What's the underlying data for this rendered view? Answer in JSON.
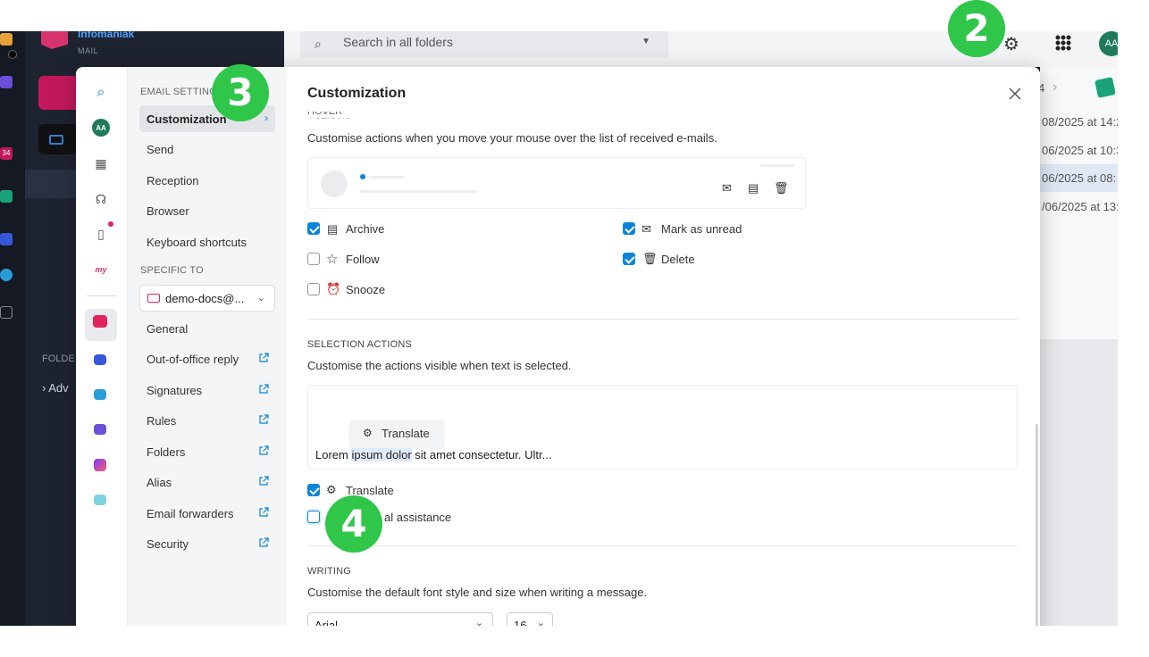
{
  "app": {
    "brand": "Infomaniak",
    "brand_sub": "MAIL",
    "avatar_initials": "AA"
  },
  "search": {
    "placeholder": "Search in all folders"
  },
  "background": {
    "rail_badge": "34",
    "folders_label": "FOLDE",
    "adv_label": "Adv",
    "pager": "4",
    "list_rows": [
      "08/2025 at 14:2",
      "06/2025 at 10:3",
      "06/2025 at 08:",
      "/06/2025 at 13:"
    ]
  },
  "modal": {
    "title": "Customization",
    "sections": {
      "email_settings": "EMAIL SETTINGS",
      "specific_to": "SPECIFIC TO"
    },
    "nav_top": [
      {
        "label": "Customization"
      },
      {
        "label": "Send"
      },
      {
        "label": "Reception"
      },
      {
        "label": "Browser"
      },
      {
        "label": "Keyboard shortcuts"
      }
    ],
    "account": "demo-docs@...",
    "nav_bottom": [
      {
        "label": "General",
        "external": false
      },
      {
        "label": "Out-of-office reply",
        "external": true
      },
      {
        "label": "Signatures",
        "external": true
      },
      {
        "label": "Rules",
        "external": true
      },
      {
        "label": "Folders",
        "external": true
      },
      {
        "label": "Alias",
        "external": true
      },
      {
        "label": "Email forwarders",
        "external": true
      },
      {
        "label": "Security",
        "external": true
      }
    ],
    "hover": {
      "description": "Customise actions when you move your mouse over the list of received e-mails.",
      "options": [
        {
          "label": "Archive",
          "checked": true,
          "icon": "archive-icon"
        },
        {
          "label": "Mark as unread",
          "checked": true,
          "icon": "mail-unread-icon"
        },
        {
          "label": "Follow",
          "checked": false,
          "icon": "star-icon"
        },
        {
          "label": "Delete",
          "checked": true,
          "icon": "trash-icon"
        },
        {
          "label": "Snooze",
          "checked": false,
          "icon": "alarm-icon"
        }
      ]
    },
    "selection": {
      "heading": "SELECTION ACTIONS",
      "description": "Customise the actions visible when text is selected.",
      "popup_label": "Translate",
      "lorem_before": "Lorem ",
      "lorem_highlight": "ipsum dolor",
      "lorem_after": " sit amet consectetur. Ultr...",
      "options": [
        {
          "label": "Translate",
          "checked": true,
          "icon": "translate-icon"
        },
        {
          "label": "al assistance",
          "checked": false
        }
      ]
    },
    "writing": {
      "heading": "WRITING",
      "description": "Customise the default font style and size when writing a message.",
      "font": "Arial",
      "size": "16"
    }
  },
  "badges": [
    "2",
    "3",
    "4"
  ]
}
